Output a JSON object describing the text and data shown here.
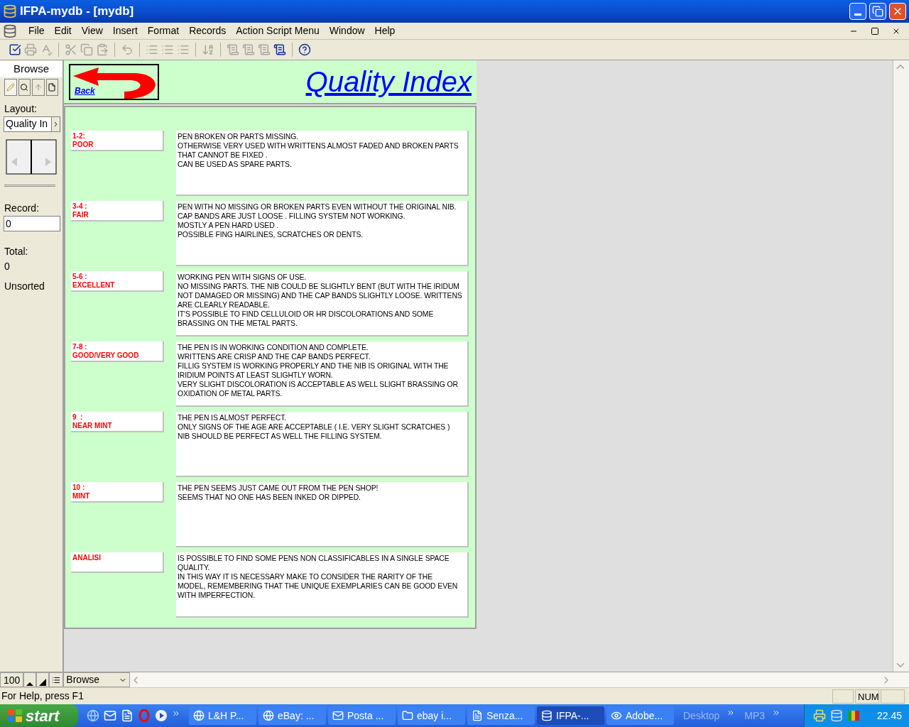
{
  "window": {
    "title": "IFPA-mydb - [mydb]"
  },
  "menu": [
    "File",
    "Edit",
    "View",
    "Insert",
    "Format",
    "Records",
    "Action Script Menu",
    "Window",
    "Help"
  ],
  "toolbar": [
    {
      "kind": "check",
      "disabled": false
    },
    {
      "kind": "print",
      "disabled": true
    },
    {
      "kind": "spell",
      "disabled": true
    },
    {
      "kind": "sep"
    },
    {
      "kind": "cut",
      "disabled": true
    },
    {
      "kind": "copy",
      "disabled": true
    },
    {
      "kind": "paste",
      "disabled": true
    },
    {
      "kind": "sep"
    },
    {
      "kind": "undo",
      "disabled": true
    },
    {
      "kind": "sep"
    },
    {
      "kind": "list",
      "disabled": true
    },
    {
      "kind": "list",
      "disabled": true
    },
    {
      "kind": "list",
      "disabled": true
    },
    {
      "kind": "sep"
    },
    {
      "kind": "sort",
      "disabled": true
    },
    {
      "kind": "sep"
    },
    {
      "kind": "script",
      "disabled": true
    },
    {
      "kind": "script",
      "disabled": true
    },
    {
      "kind": "script",
      "disabled": true
    },
    {
      "kind": "script",
      "disabled": false
    },
    {
      "kind": "sep"
    },
    {
      "kind": "help",
      "disabled": false
    }
  ],
  "status_panel": {
    "mode": "Browse",
    "layout_label": "Layout:",
    "layout_value": "Quality In",
    "record_label": "Record:",
    "record_value": "0",
    "total_label": "Total:",
    "total_value": "0",
    "sort_state": "Unsorted"
  },
  "header": {
    "back_label": "Back",
    "title": "Quality Index"
  },
  "rows": [
    {
      "score": "1-2:",
      "grade": "POOR",
      "lines": [
        "PEN BROKEN OR PARTS MISSING.",
        "OTHERWISE VERY USED WITH WRITTENS ALMOST FADED AND BROKEN PARTS",
        "THAT CANNOT BE FIXED .",
        "CAN BE USED AS SPARE PARTS."
      ]
    },
    {
      "score": "3-4 :",
      "grade": "FAIR",
      "lines": [
        "PEN WITH NO MISSING OR BROKEN PARTS EVEN WITHOUT THE ORIGINAL NIB.",
        "CAP BANDS ARE JUST LOOSE . FILLING SYSTEM NOT WORKING.",
        "MOSTLY A PEN HARD USED .",
        "POSSIBLE FING HAIRLINES, SCRATCHES OR DENTS."
      ]
    },
    {
      "score": "5-6 :",
      "grade": "EXCELLENT",
      "lines": [
        "WORKING PEN WITH SIGNS OF USE.",
        "NO MISSING PARTS. THE NIB COULD BE SLIGHTLY BENT (BUT WITH THE IRIDUM",
        "NOT DAMAGED OR MISSING) AND THE CAP BANDS SLIGHTLY LOOSE. WRITTENS",
        "ARE CLEARLY READABLE.",
        "IT'S POSSIBLE TO FIND CELLULOID OR HR DISCOLORATIONS AND SOME",
        "BRASSING ON THE METAL PARTS."
      ]
    },
    {
      "score": "7-8 :",
      "grade": "GOOD/VERY GOOD",
      "lines": [
        "THE PEN IS IN WORKING CONDITION AND COMPLETE.",
        "WRITTENS ARE CRISP AND THE CAP BANDS PERFECT.",
        "FILLIG SYSTEM IS WORKING PROPERLY AND THE NIB IS ORIGINAL WITH THE",
        "IRIDIUM POINTS AT LEAST SLIGHTLY WORN.",
        "VERY SLIGHT DISCOLORATION IS ACCEPTABLE AS WELL SLIGHT BRASSING OR",
        "OXIDATION OF METAL PARTS."
      ]
    },
    {
      "score": "9  :",
      "grade": "NEAR MINT",
      "lines": [
        "THE PEN IS ALMOST PERFECT.",
        "ONLY SIGNS OF THE AGE ARE ACCEPTABLE ( I.E. VERY SLIGHT SCRATCHES )",
        "NIB SHOULD BE PERFECT AS WELL THE FILLING SYSTEM."
      ]
    },
    {
      "score": "10 :",
      "grade": "MINT",
      "lines": [
        "THE PEN SEEMS JUST CAME OUT FROM THE PEN SHOP!",
        "SEEMS THAT NO ONE HAS BEEN INKED OR DIPPED."
      ]
    },
    {
      "grade": "ANALISI",
      "lines": [
        "IS POSSIBLE TO FIND SOME PENS NON CLASSIFICABLES IN A SINGLE SPACE",
        "QUALITY.",
        "IN THIS WAY IT IS NECESSARY MAKE TO CONSIDER THE RARITY OF THE",
        "MODEL, REMEMBERING THAT THE UNIQUE EXEMPLARIES CAN BE GOOD EVEN",
        "WITH IMPERFECTION."
      ]
    }
  ],
  "bottom_bar": {
    "zoom": "100",
    "mode": "Browse"
  },
  "status_bar": {
    "help": "For Help, press F1",
    "num": "NUM"
  },
  "taskbar": {
    "start": "start",
    "tasks": [
      {
        "label": "L&H P...",
        "kind": "globe",
        "selected": false
      },
      {
        "label": "eBay: ...",
        "kind": "ie",
        "selected": false
      },
      {
        "label": "Posta ...",
        "kind": "mail",
        "selected": false
      },
      {
        "label": "ebay i...",
        "kind": "folder",
        "selected": false
      },
      {
        "label": "Senza...",
        "kind": "doc",
        "selected": false
      },
      {
        "label": "IFPA-...",
        "kind": "db",
        "selected": true
      },
      {
        "label": "Adobe...",
        "kind": "eye",
        "selected": false
      }
    ],
    "toolbars": [
      "Desktop",
      "MP3"
    ],
    "clock": "22.45"
  }
}
